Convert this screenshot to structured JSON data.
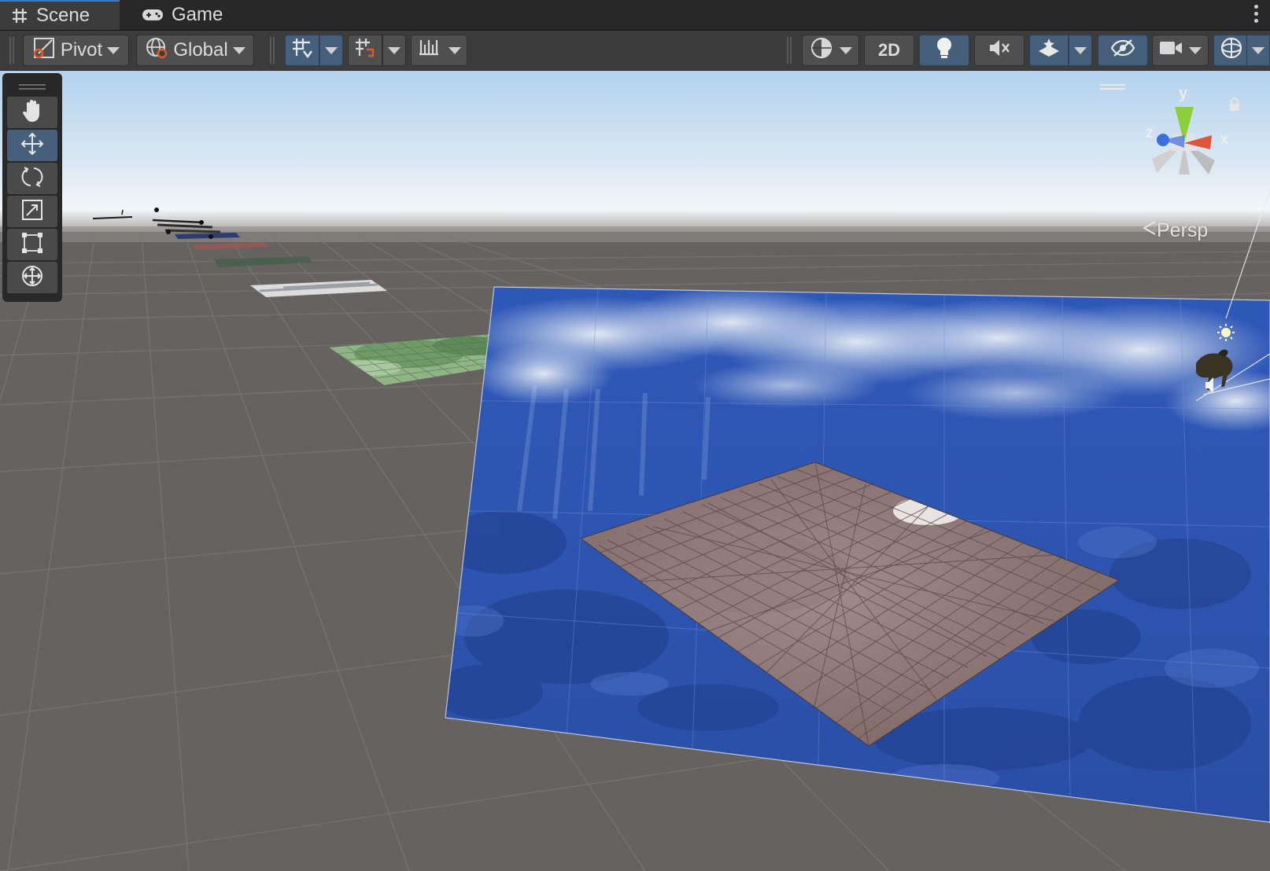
{
  "tabs": [
    {
      "label": "Scene",
      "icon": "grid-icon",
      "active": true
    },
    {
      "label": "Game",
      "icon": "gamepad-icon",
      "active": false
    }
  ],
  "toolbar": {
    "pivot_label": "Pivot",
    "global_label": "Global",
    "mode_2d_label": "2D"
  },
  "tools": [
    {
      "name": "hand-tool",
      "icon": "hand-icon",
      "active": false
    },
    {
      "name": "move-tool",
      "icon": "move-icon",
      "active": true
    },
    {
      "name": "rotate-tool",
      "icon": "rotate-icon",
      "active": false
    },
    {
      "name": "scale-tool",
      "icon": "scale-icon",
      "active": false
    },
    {
      "name": "rect-tool",
      "icon": "rect-transform-icon",
      "active": false
    },
    {
      "name": "transform-tool",
      "icon": "transform-icon",
      "active": false
    }
  ],
  "gizmo": {
    "y_label": "y",
    "x_label": "x",
    "z_label": "z",
    "projection_label": "Persp"
  },
  "colors": {
    "accent": "#3a79bb",
    "active_button": "#46607c",
    "toolbar": "#3c3c3c",
    "tabbar": "#282828",
    "ground": "#656260"
  }
}
